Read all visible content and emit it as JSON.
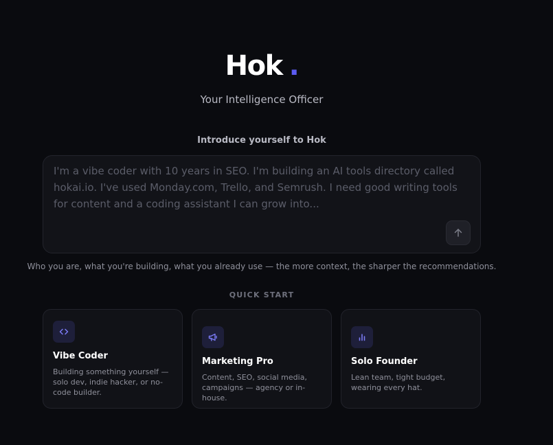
{
  "brand": {
    "name": "Hok",
    "dot": ".",
    "accent_color": "#5b5bf0",
    "tagline": "Your Intelligence Officer"
  },
  "intro": {
    "label": "Introduce yourself to Hok",
    "value": "",
    "placeholder": "I'm a vibe coder with 10 years in SEO. I'm building an AI tools directory called hokai.io. I've used Monday.com, Trello, and Semrush. I need good writing tools for content and a coding assistant I can grow into...",
    "send_icon": "arrow-up-icon",
    "helper": "Who you are, what you're building, what you already use — the more context, the sharper the recommendations."
  },
  "quick_start": {
    "heading": "QUICK START",
    "cards": [
      {
        "icon": "code-icon",
        "title": "Vibe Coder",
        "description": "Building something yourself — solo dev, indie hacker, or no-code builder."
      },
      {
        "icon": "megaphone-icon",
        "title": "Marketing Pro",
        "description": "Content, SEO, social media, campaigns — agency or in-house."
      },
      {
        "icon": "bar-chart-icon",
        "title": "Solo Founder",
        "description": "Lean team, tight budget, wearing every hat."
      }
    ]
  }
}
